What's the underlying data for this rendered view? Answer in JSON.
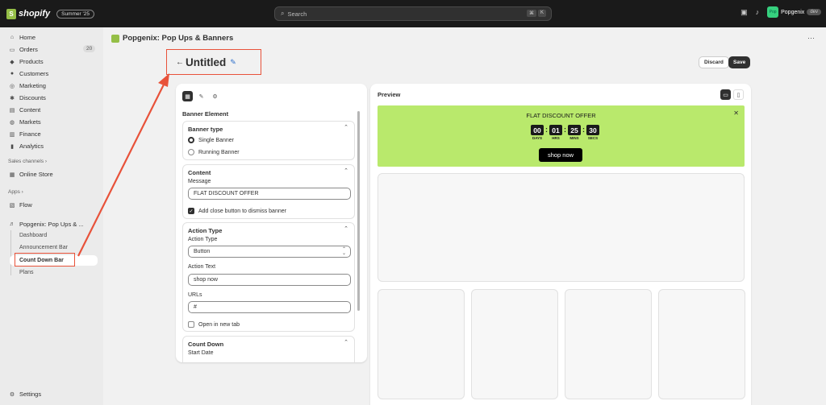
{
  "topbar": {
    "logo_glyph": "S",
    "brand": "shopify",
    "season_badge": "Summer '25",
    "search_placeholder": "Search",
    "search_key1": "⌘",
    "search_key2": "K",
    "store_avatar": "Pop",
    "store_name": "Popgenix",
    "env_badge": "dev"
  },
  "sidebar": {
    "items": [
      {
        "label": "Home",
        "icon": "home-icon",
        "glyph": "⌂"
      },
      {
        "label": "Orders",
        "icon": "orders-icon",
        "glyph": "▭"
      },
      {
        "label": "Products",
        "icon": "tag-icon",
        "glyph": "◆"
      },
      {
        "label": "Customers",
        "icon": "person-icon",
        "glyph": "●"
      },
      {
        "label": "Marketing",
        "icon": "target-icon",
        "glyph": "◎"
      },
      {
        "label": "Discounts",
        "icon": "discount-icon",
        "glyph": "✱"
      },
      {
        "label": "Content",
        "icon": "content-icon",
        "glyph": "▤"
      },
      {
        "label": "Markets",
        "icon": "globe-icon",
        "glyph": "◍"
      },
      {
        "label": "Finance",
        "icon": "finance-icon",
        "glyph": "▥"
      },
      {
        "label": "Analytics",
        "icon": "analytics-icon",
        "glyph": "▮"
      }
    ],
    "orders_count": "20",
    "sales_channels_label": "Sales channels ›",
    "online_store": "Online Store",
    "apps_label": "Apps ›",
    "flow": "Flow",
    "app_name": "Popgenix: Pop Ups & ...",
    "sub_items": [
      "Dashboard",
      "Announcement Bar",
      "Count Down Bar",
      "Plans"
    ],
    "settings": "Settings"
  },
  "header": {
    "app_title": "Popgenix: Pop Ups & Banners",
    "page_title": "Untitled",
    "back_glyph": "←",
    "discard": "Discard",
    "save": "Save"
  },
  "editor": {
    "heading": "Banner Element",
    "banner_type": {
      "title": "Banner type",
      "options": [
        "Single Banner",
        "Running Banner"
      ],
      "selected": "Single Banner"
    },
    "content": {
      "title": "Content",
      "message_label": "Message",
      "message_value": "FLAT DISCOUNT OFFER",
      "close_checkbox_label": "Add close button to dismiss banner"
    },
    "action": {
      "title": "Action Type",
      "type_label": "Action Type",
      "type_value": "Button",
      "text_label": "Action Text",
      "text_value": "shop now",
      "urls_label": "URLs",
      "urls_value": "#",
      "new_tab_label": "Open in new tab"
    },
    "countdown": {
      "title": "Count Down",
      "start_date_label": "Start Date"
    }
  },
  "preview": {
    "title": "Preview",
    "banner_message": "FLAT DISCOUNT OFFER",
    "banner_color": "#b9e96c",
    "timer": [
      {
        "value": "00",
        "label": "DAYS"
      },
      {
        "value": "01",
        "label": "HRS"
      },
      {
        "value": "25",
        "label": "MINS"
      },
      {
        "value": "30",
        "label": "SECS"
      }
    ],
    "button_text": "shop now"
  },
  "annotation_color": "#e8523a"
}
